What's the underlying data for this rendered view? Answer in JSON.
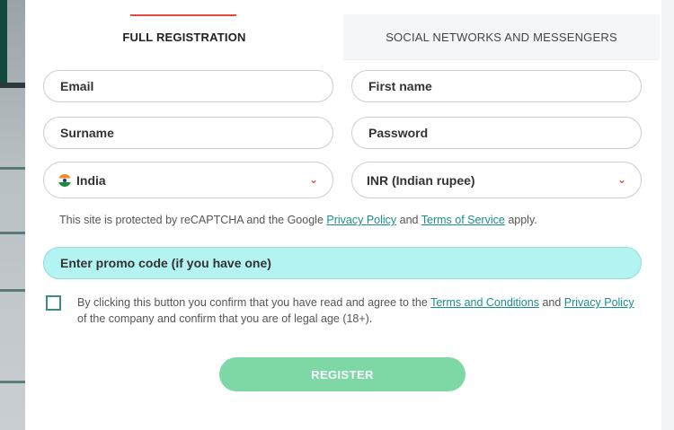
{
  "tabs": {
    "full_registration": "FULL REGISTRATION",
    "social": "SOCIAL NETWORKS AND MESSENGERS"
  },
  "fields": {
    "email": "Email",
    "first_name": "First name",
    "surname": "Surname",
    "password": "Password"
  },
  "country": {
    "value": "India",
    "flag_icon": "india-flag-icon"
  },
  "currency": {
    "value": "INR (Indian rupee)"
  },
  "captcha": {
    "prefix": "This site is protected by reCAPTCHA and the Google ",
    "privacy_link": "Privacy Policy",
    "middle": " and ",
    "terms_link": "Terms of Service",
    "suffix": " apply."
  },
  "promo": {
    "label": "Enter promo code (if you have one)"
  },
  "agreement": {
    "prefix": "By clicking this button you confirm that you have read and agree to the ",
    "terms_link": "Terms and Conditions",
    "middle": " and ",
    "privacy_link": "Privacy Policy",
    "suffix": " of the company and confirm that you are of legal age (18+).",
    "checked": false
  },
  "register_label": "REGISTER",
  "colors": {
    "accent_red": "#e8453c",
    "link_teal": "#1a8e8e",
    "promo_bg": "#b3f3f1",
    "register_bg": "#7dd8a6"
  }
}
